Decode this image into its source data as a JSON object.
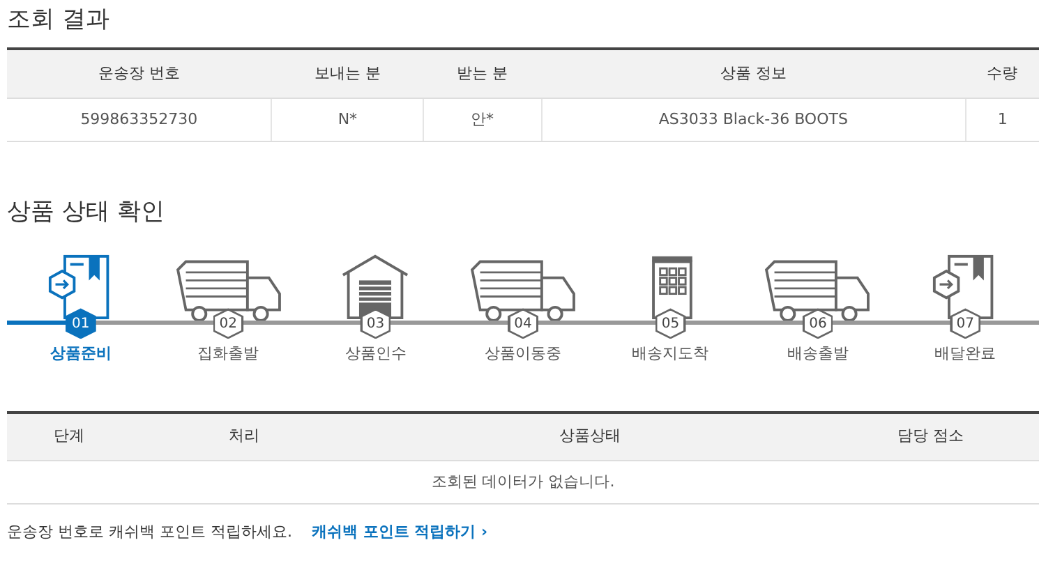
{
  "result_title": "조회 결과",
  "result_table": {
    "columns": [
      "운송장 번호",
      "보내는 분",
      "받는 분",
      "상품 정보",
      "수량"
    ],
    "rows": [
      [
        "599863352730",
        "N*",
        "안*",
        "AS3033 Black-36 BOOTS",
        "1"
      ]
    ]
  },
  "status_title": "상품 상태 확인",
  "steps": [
    {
      "kind": "box",
      "number": "01",
      "label": "상품준비",
      "selected": true
    },
    {
      "kind": "truck",
      "number": "02",
      "label": "집화출발",
      "selected": false
    },
    {
      "kind": "warehouse",
      "number": "03",
      "label": "상품인수",
      "selected": false
    },
    {
      "kind": "truck",
      "number": "04",
      "label": "상품이동중",
      "selected": false
    },
    {
      "kind": "building",
      "number": "05",
      "label": "배송지도착",
      "selected": false
    },
    {
      "kind": "truck",
      "number": "06",
      "label": "배송출발",
      "selected": false
    },
    {
      "kind": "box",
      "number": "07",
      "label": "배달완료",
      "selected": false
    }
  ],
  "history_table": {
    "columns": [
      "단계",
      "처리",
      "상품상태",
      "담당 점소"
    ],
    "empty_message": "조회된 데이터가 없습니다."
  },
  "footer": {
    "text": "운송장 번호로 캐쉬백 포인트 적립하세요.",
    "link": "캐쉬백 포인트 적립하기",
    "link_arrow": "›"
  }
}
